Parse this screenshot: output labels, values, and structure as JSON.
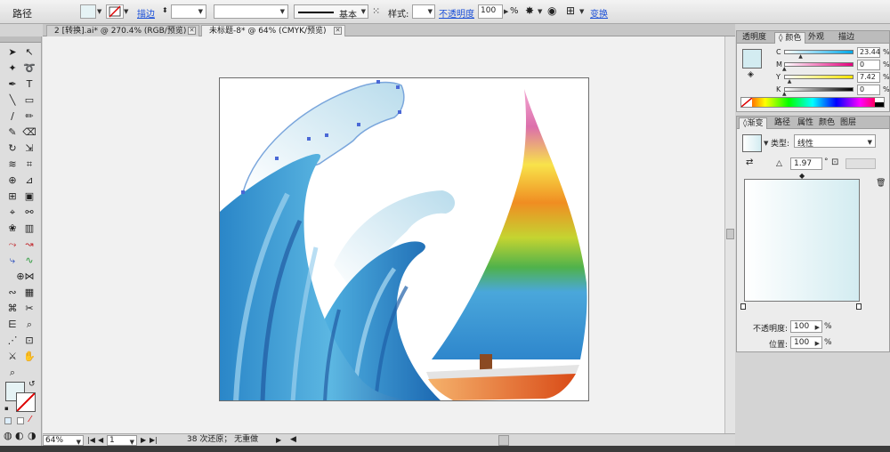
{
  "control_bar": {
    "object_type": "路径",
    "stroke_link": "描边",
    "stroke_profile": "基本",
    "style_label": "样式:",
    "opacity_link": "不透明度",
    "opacity_value": "100",
    "percent": "%",
    "transform_link": "变换"
  },
  "doc_tabs": [
    {
      "label": "2 [转换].ai* @ 270.4% (RGB/预览)"
    },
    {
      "label": "未标题-8* @ 64% (CMYK/预览)"
    }
  ],
  "tools": {
    "icons": [
      "selection-icon",
      "direct-selection-icon",
      "magic-wand-icon",
      "lasso-icon",
      "pen-icon",
      "type-icon",
      "line-icon",
      "rectangle-icon",
      "paintbrush-icon",
      "pencil-icon",
      "blob-brush-icon",
      "eraser-icon",
      "rotate-icon",
      "scale-icon",
      "warp-icon",
      "free-transform-icon",
      "shape-builder-icon",
      "perspective-icon",
      "mesh-icon",
      "gradient-icon",
      "eyedropper-icon",
      "blend-icon",
      "symbol-sprayer-icon",
      "column-graph-icon",
      "blend-red-icon",
      "curvature-red-icon",
      "blend-blue-icon",
      "curvature-green-icon",
      "crosshair-icon",
      "width-icon",
      "warp-wave-icon",
      "grid-icon",
      "twist-icon",
      "scissors-icon",
      "ruler-icon",
      "eyedropper-alt-icon",
      "slice-icon",
      "artboard-icon",
      "knife-icon",
      "hand-icon",
      "zoom-icon"
    ]
  },
  "status_bar": {
    "zoom": "64%",
    "page": "1",
    "undo_text": "38 次还原； 无重做"
  },
  "color_panel": {
    "tabs": [
      "透明度",
      "颜色",
      "外观",
      "描边"
    ],
    "active_tab": 1,
    "rows": [
      {
        "label": "C",
        "value": "23.44",
        "fraction": 0.2344
      },
      {
        "label": "M",
        "value": "0",
        "fraction": 0
      },
      {
        "label": "Y",
        "value": "7.42",
        "fraction": 0.0742
      },
      {
        "label": "K",
        "value": "0",
        "fraction": 0
      }
    ],
    "percent": "%",
    "swatch_color": "#d3ecf1"
  },
  "gradient_panel": {
    "tabs": [
      "渐变",
      "路径",
      "属性",
      "颜色",
      "图层"
    ],
    "active_tab": 0,
    "type_label": "类型:",
    "type_value": "线性",
    "angle_value": "1.97",
    "degree": "°",
    "opacity_label": "不透明度:",
    "opacity_value": "100",
    "location_label": "位置:",
    "location_value": "100",
    "percent": "%",
    "start_color": "#ffffff",
    "end_color": "#d3ecf1"
  },
  "colors": {
    "fill": "#e6f3f5",
    "accent_link": "#1a4fd8"
  }
}
